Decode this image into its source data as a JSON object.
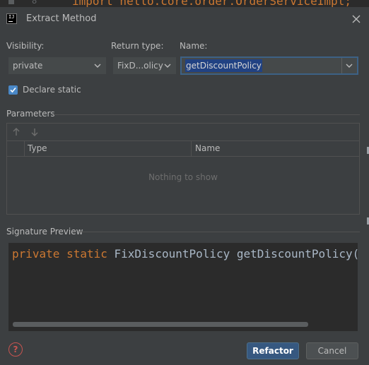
{
  "background_editor": {
    "line_number": "8",
    "code": "import hello.core.order.OrderServiceImpl;"
  },
  "dialog": {
    "title": "Extract Method",
    "visibility": {
      "label": "Visibility:",
      "value": "private"
    },
    "return_type": {
      "label": "Return type:",
      "value": "FixD...olicy"
    },
    "name": {
      "label": "Name:",
      "value": "getDiscountPolicy"
    },
    "declare_static": {
      "label": "Declare static",
      "checked": true
    },
    "parameters": {
      "title": "Parameters",
      "columns": [
        "Type",
        "Name"
      ],
      "empty_text": "Nothing to show"
    },
    "signature_preview": {
      "title": "Signature Preview",
      "kw1": "private",
      "kw2": "static",
      "rest": "FixDiscountPolicy getDiscountPolicy()"
    },
    "buttons": {
      "refactor": "Refactor",
      "cancel": "Cancel",
      "help": "?"
    }
  },
  "colors": {
    "accent": "#4a88c7",
    "keyword": "#cc7832",
    "primary_button": "#365880",
    "help": "#c75450"
  }
}
